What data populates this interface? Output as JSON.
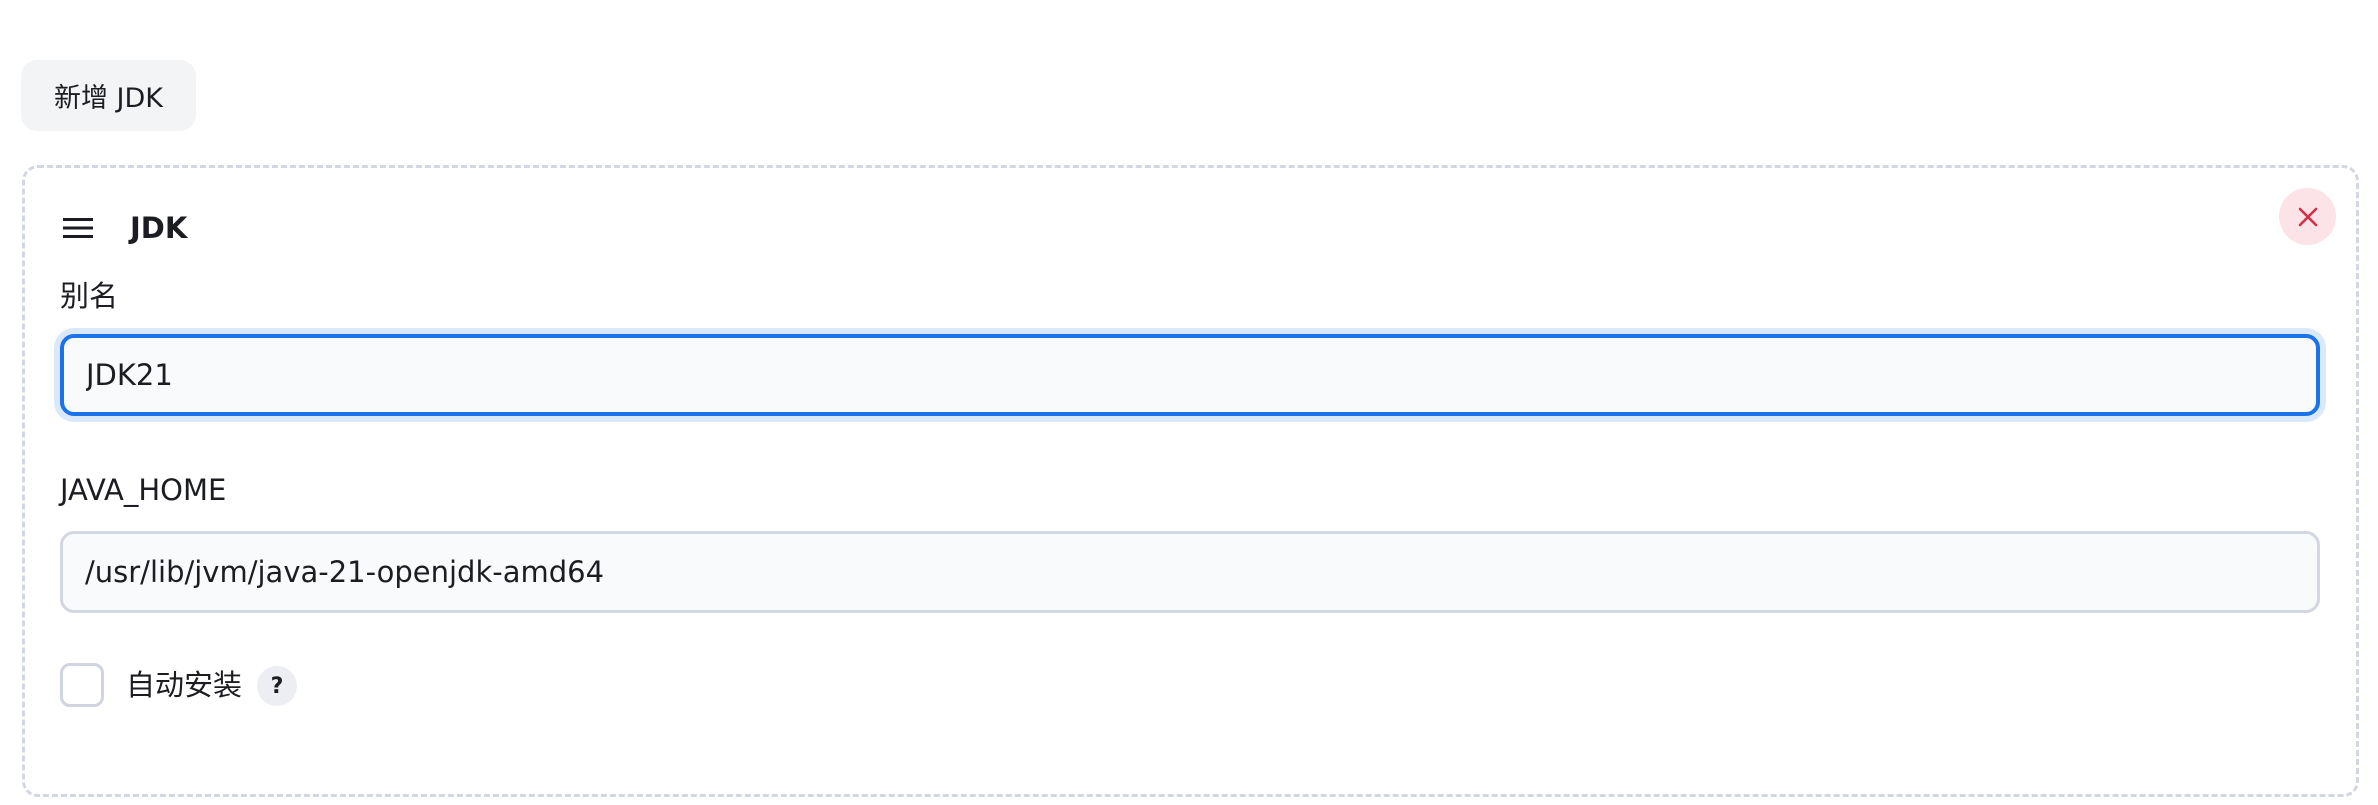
{
  "add_button": {
    "label": "新增 JDK"
  },
  "jdk_panel": {
    "title": "JDK",
    "alias_field": {
      "label": "别名",
      "value": "JDK21"
    },
    "java_home_field": {
      "label": "JAVA_HOME",
      "value": "/usr/lib/jvm/java-21-openjdk-amd64"
    },
    "auto_install": {
      "label": "自动安装",
      "checked": false,
      "help_label": "?"
    }
  },
  "icons": {
    "drag": "drag-handle-icon",
    "close": "close-icon"
  },
  "colors": {
    "focus_border": "#1a73e8",
    "close_bg": "#fbe3e7",
    "close_icon": "#d32f45"
  }
}
